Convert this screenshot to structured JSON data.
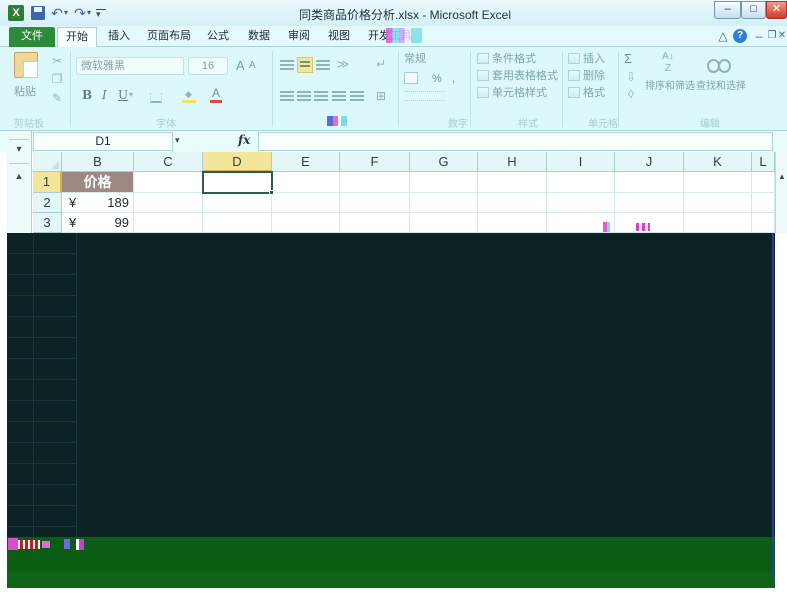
{
  "window": {
    "title": "同类商品价格分析.xlsx - Microsoft Excel"
  },
  "icons": {
    "quick_access": [
      "excel-icon",
      "save-icon",
      "undo-icon",
      "redo-icon",
      "customize-icon"
    ],
    "window_controls": [
      "minimize-icon",
      "maximize-icon",
      "close-icon"
    ],
    "ribbon_right": [
      "minimize-ribbon-icon",
      "help-icon",
      "workbook-minimize-icon",
      "workbook-restore-icon",
      "workbook-close-icon"
    ]
  },
  "tabs": [
    {
      "label": "文件"
    },
    {
      "label": "开始",
      "selected": true
    },
    {
      "label": "插入"
    },
    {
      "label": "页面布局"
    },
    {
      "label": "公式"
    },
    {
      "label": "数据"
    },
    {
      "label": "审阅"
    },
    {
      "label": "视图"
    },
    {
      "label": "开发工具"
    }
  ],
  "ribbon": {
    "clipboard": {
      "paste": "粘贴",
      "label": "剪贴板"
    },
    "font": {
      "name": "微软雅黑",
      "size": "16",
      "grow": "A",
      "shrink": "A",
      "bold": "B",
      "italic": "I",
      "underline": "U",
      "font_color": "A",
      "label": "字体"
    },
    "number": {
      "format": "常规",
      "percent": "%",
      "comma": ",",
      "label": "数字"
    },
    "styles": {
      "conditional": "条件格式",
      "table": "套用表格格式",
      "cell_styles": "单元格样式",
      "label": "样式"
    },
    "cells": {
      "insert": "插入",
      "delete": "删除",
      "format": "格式",
      "label": "单元格"
    },
    "editing": {
      "sum": "Σ",
      "sort_filter": "排序和筛选",
      "find_select": "查找和选择",
      "label": "编辑"
    }
  },
  "formula_bar": {
    "name_box": "D1",
    "fx": "fx"
  },
  "sheet": {
    "columns": [
      {
        "letter": "B"
      },
      {
        "letter": "C"
      },
      {
        "letter": "D",
        "selected": true
      },
      {
        "letter": "E"
      },
      {
        "letter": "F"
      },
      {
        "letter": "G"
      },
      {
        "letter": "H"
      },
      {
        "letter": "I"
      },
      {
        "letter": "J"
      },
      {
        "letter": "K"
      },
      {
        "letter": "L"
      }
    ],
    "rows": [
      {
        "num": "1",
        "selected": true,
        "B": "价格"
      },
      {
        "num": "2",
        "B_currency": "¥",
        "B": "189"
      },
      {
        "num": "3",
        "B_currency": "¥",
        "B": "99"
      }
    ]
  },
  "colors": {
    "file_tab": "#2c8c3a",
    "ribbon_bg": "#dcf8fa",
    "header_cell_fill": "#9e8884",
    "active_cell_border": "#2b5c52",
    "selected_header": "#f4e59c",
    "corrupted_dark": "#0c2326",
    "corrupted_green": "#0b5d13"
  }
}
